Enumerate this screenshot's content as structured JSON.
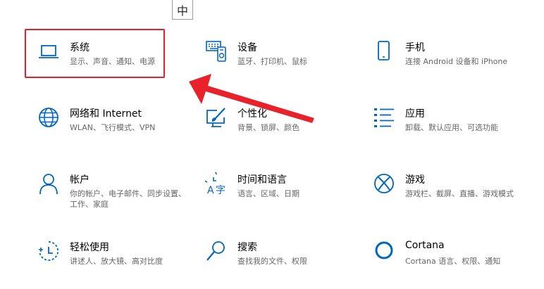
{
  "ime": {
    "label": "中"
  },
  "colors": {
    "accent": "#0067c0",
    "highlight_box": "#e3212b",
    "arrow": "#e8212b",
    "desc_text": "#666666"
  },
  "tiles": [
    {
      "name": "system",
      "icon": "laptop-icon",
      "title": "系统",
      "desc": "显示、声音、通知、电源"
    },
    {
      "name": "devices",
      "icon": "devices-icon",
      "title": "设备",
      "desc": "蓝牙、打印机、鼠标"
    },
    {
      "name": "phone",
      "icon": "phone-icon",
      "title": "手机",
      "desc": "连接 Android 设备和 iPhone"
    },
    {
      "name": "network",
      "icon": "globe-icon",
      "title": "网络和 Internet",
      "desc": "WLAN、飞行模式、VPN"
    },
    {
      "name": "personalization",
      "icon": "personalize-icon",
      "title": "个性化",
      "desc": "背景、锁屏、颜色"
    },
    {
      "name": "apps",
      "icon": "apps-list-icon",
      "title": "应用",
      "desc": "卸载、默认应用、可选功能"
    },
    {
      "name": "accounts",
      "icon": "person-icon",
      "title": "帐户",
      "desc": "你的帐户、电子邮件、同步设置、工作、家庭"
    },
    {
      "name": "time-language",
      "icon": "time-language-icon",
      "title": "时间和语言",
      "desc": "语言、区域、日期"
    },
    {
      "name": "gaming",
      "icon": "xbox-icon",
      "title": "游戏",
      "desc": "游戏栏、截屏、直播、游戏模式"
    },
    {
      "name": "ease-of-access",
      "icon": "ease-access-icon",
      "title": "轻松使用",
      "desc": "讲述人、放大镜、高对比度"
    },
    {
      "name": "search",
      "icon": "search-icon",
      "title": "搜索",
      "desc": "查找我的文件、权限"
    },
    {
      "name": "cortana",
      "icon": "cortana-icon",
      "title": "Cortana",
      "desc": "Cortana 语言、权限、通知"
    }
  ]
}
